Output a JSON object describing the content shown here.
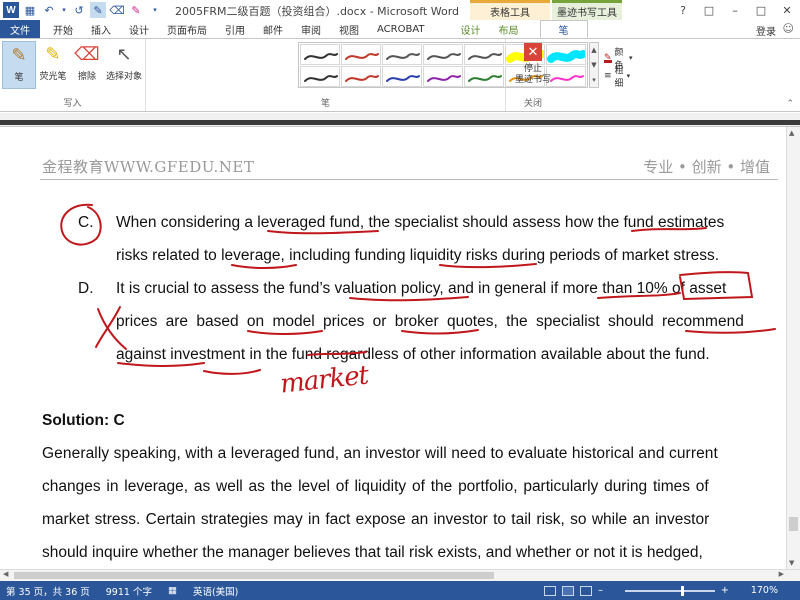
{
  "window": {
    "title": "2005FRM二级百题（投资组合）.docx - Microsoft Word",
    "context_table_tools": "表格工具",
    "context_ink_tools": "墨迹书写工具"
  },
  "tabs": [
    {
      "label": "文件"
    },
    {
      "label": "开始"
    },
    {
      "label": "插入"
    },
    {
      "label": "设计"
    },
    {
      "label": "页面布局"
    },
    {
      "label": "引用"
    },
    {
      "label": "邮件"
    },
    {
      "label": "审阅"
    },
    {
      "label": "视图"
    },
    {
      "label": "ACROBAT"
    },
    {
      "label": "设计"
    },
    {
      "label": "布局"
    },
    {
      "label": "笔"
    }
  ],
  "signin": "登录",
  "ribbon": {
    "write_group": {
      "label": "写入",
      "buttons": [
        {
          "label": "笔",
          "icon": "pen-icon"
        },
        {
          "label": "荧光笔",
          "icon": "highlighter-icon"
        },
        {
          "label": "擦除",
          "icon": "eraser-icon"
        },
        {
          "label": "选择对象",
          "icon": "select-cursor-icon"
        }
      ]
    },
    "pens_group": {
      "label": "笔",
      "color_label": "颜色",
      "thickness_label": "粗细",
      "pen_colors": [
        "#333333",
        "#c0392b",
        "#555555",
        "#555555",
        "#555555",
        "#ffff00",
        "#00e5ff",
        "#333333",
        "#c0392b",
        "#2b3fb0",
        "#8e24aa",
        "#2e7d32",
        "#e8940c",
        "#ff33cc"
      ]
    },
    "close_group": {
      "label": "关闭",
      "stop_label_line1": "停止",
      "stop_label_line2": "墨迹书写"
    }
  },
  "document": {
    "header_left": "金程教育WWW.GFEDU.NET",
    "header_right": "专业 • 创新 • 增值",
    "option_c": {
      "label": "C.",
      "line1": "When considering a leveraged fund, the specialist should assess how the fund estimates",
      "line2": "risks related to leverage, including funding liquidity risks during periods of market stress."
    },
    "option_d": {
      "label": "D.",
      "line1": "It is crucial to assess the fund’s valuation policy, and in general if more than 10% of asset",
      "line2": "prices are based on model prices or broker quotes, the specialist should recommend",
      "line3": "against investment in the fund regardless of other information available about the fund."
    },
    "handwritten_note": "market",
    "solution_title": "Solution: C",
    "solution_lines": [
      "Generally speaking, with a leveraged fund, an investor will need to evaluate historical and current",
      "changes in leverage, as well as the level of liquidity of the portfolio, particularly during times of",
      "market stress. Certain strategies may in fact expose an investor to tail risk, so while an investor",
      "should inquire whether the manager believes that tail risk exists, and whether or not it is hedged,"
    ]
  },
  "status": {
    "page": "第 35 页，共 36 页",
    "words": "9911 个字",
    "language": "英语(美国)",
    "zoom": "170%",
    "zoom_fraction": 0.62
  },
  "colors": {
    "accent": "#2b579a",
    "ink_red": "#c0171c"
  }
}
